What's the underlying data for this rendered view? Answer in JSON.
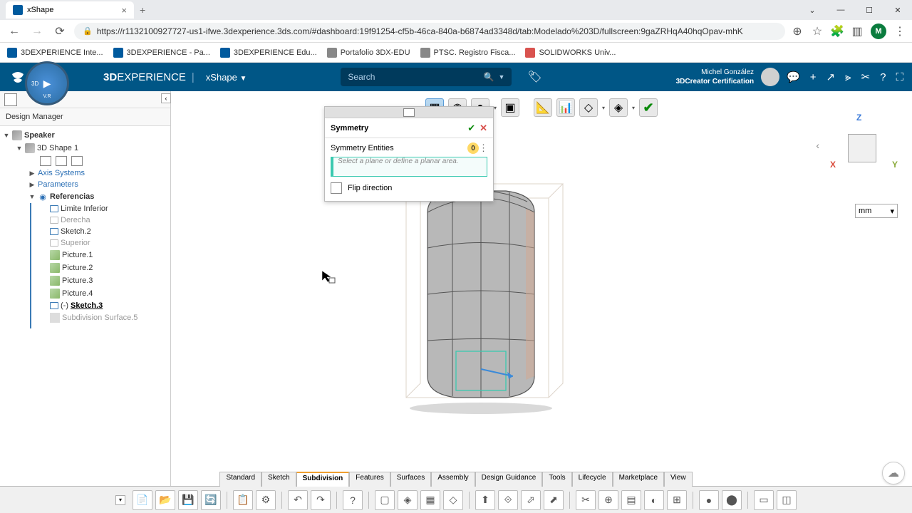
{
  "browser": {
    "tab_title": "xShape",
    "url": "https://r1132100927727-us1-ifwe.3dexperience.3ds.com/#dashboard:19f91254-cf5b-46ca-840a-b6874ad3348d/tab:Modelado%203D/fullscreen:9gaZRHqA40hqOpav-mhK",
    "bookmarks": [
      "3DEXPERIENCE Inte...",
      "3DEXPERIENCE - Pa...",
      "3DEXPERIENCE Edu...",
      "Portafolio 3DX-EDU",
      "PTSC. Registro Fisca...",
      "SOLIDWORKS Univ..."
    ]
  },
  "header": {
    "brand_bold": "3D",
    "brand_light": "EXPERIENCE",
    "app_name": "xShape",
    "search_placeholder": "Search",
    "user_name": "Michel González",
    "user_cert": "3DCreator Certification"
  },
  "sidebar": {
    "dm_label": "Design Manager",
    "root": "Speaker",
    "shape": "3D Shape 1",
    "axis": "Axis Systems",
    "params": "Parameters",
    "refs": "Referencias",
    "items": {
      "limite": "Limite Inferior",
      "derecha": "Derecha",
      "sketch2": "Sketch.2",
      "superior": "Superior",
      "pic1": "Picture.1",
      "pic2": "Picture.2",
      "pic3": "Picture.3",
      "pic4": "Picture.4",
      "sketch3_prefix": "(-)",
      "sketch3": "Sketch.3",
      "sub_surface": "Subdivision Surface.5"
    }
  },
  "panel": {
    "title": "Symmetry",
    "entities_label": "Symmetry Entities",
    "entities_count": "0",
    "input_placeholder": "Select a plane or define a planar area.",
    "flip_label": "Flip direction"
  },
  "viewport": {
    "axes": {
      "x": "X",
      "y": "Y",
      "z": "Z"
    },
    "unit": "mm",
    "compass_label": "V.R"
  },
  "bottom": {
    "tabs": [
      "Standard",
      "Sketch",
      "Subdivision",
      "Features",
      "Surfaces",
      "Assembly",
      "Design Guidance",
      "Tools",
      "Lifecycle",
      "Marketplace",
      "View"
    ],
    "active_tab": 2
  }
}
